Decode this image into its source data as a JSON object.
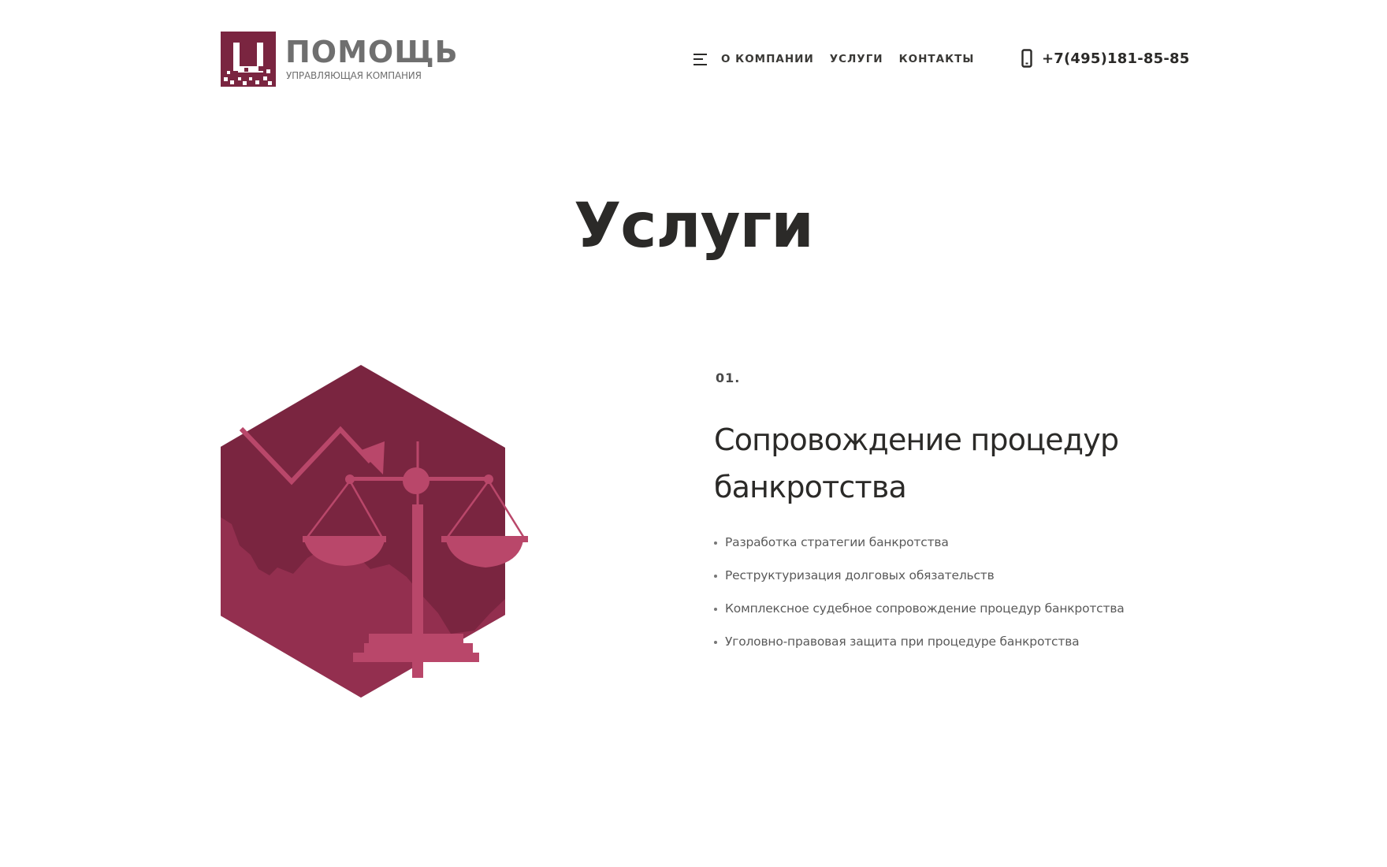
{
  "colors": {
    "brand": "#7a2540",
    "brand_dark": "#6d2138",
    "brand_mid": "#932f4f",
    "brand_light": "#b9476a",
    "text": "#2b2a28",
    "muted": "#5a5a5a"
  },
  "header": {
    "logo": {
      "icon": "logo-mark-icon",
      "name": "ПОМОЩЬ",
      "tagline": "УПРАВЛЯЮЩАЯ КОМПАНИЯ"
    },
    "nav": {
      "menu_icon": "hamburger-icon",
      "items": [
        "О КОМПАНИИ",
        "УСЛУГИ",
        "КОНТАКТЫ"
      ]
    },
    "phone": {
      "icon": "mobile-phone-icon",
      "number": "+7(495)181-85-85"
    }
  },
  "main": {
    "title": "Услуги",
    "service": {
      "number": "01.",
      "title": "Сопровождение процедур банкротства",
      "illustration_icon": "scales-of-justice-icon",
      "items": [
        "Разработка стратегии банкротства",
        "Реструктуризация долговых обязательств",
        "Комплексное судебное сопровождение процедур банкротства",
        "Уголовно-правовая защита при процедуре банкротства"
      ]
    }
  }
}
